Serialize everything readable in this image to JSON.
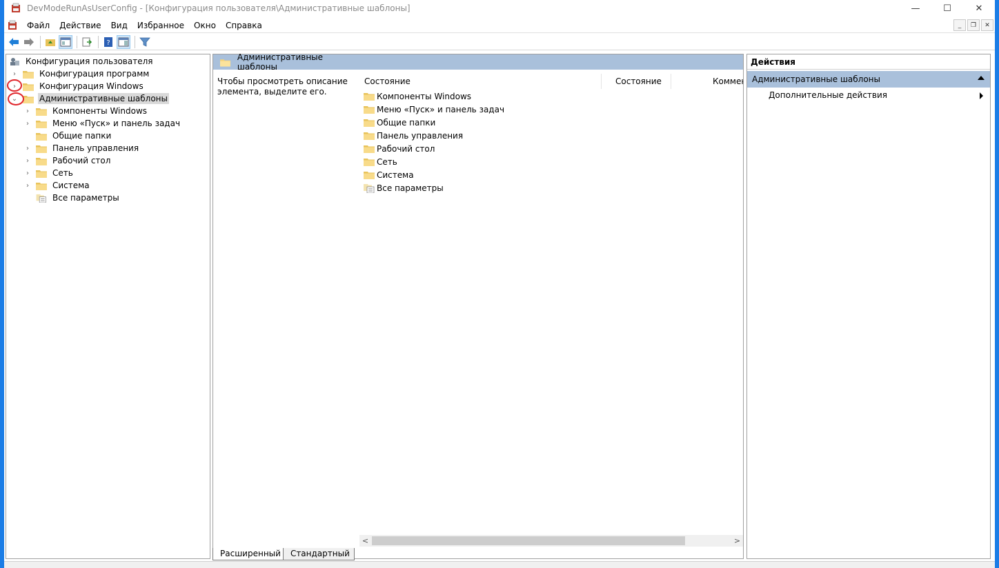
{
  "window": {
    "title": "DevModeRunAsUserConfig - [Конфигурация пользователя\\Административные шаблоны]",
    "minimize": "—",
    "maximize": "☐",
    "close": "✕"
  },
  "menu": {
    "items": [
      "Файл",
      "Действие",
      "Вид",
      "Избранное",
      "Окно",
      "Справка"
    ],
    "mdi_minimize": "_",
    "mdi_restore": "❐",
    "mdi_close": "✕"
  },
  "tree": {
    "root": "Конфигурация пользователя",
    "items": [
      {
        "label": "Конфигурация программ",
        "level": 1,
        "expander": "›"
      },
      {
        "label": "Конфигурация Windows",
        "level": 1,
        "expander": "›"
      },
      {
        "label": "Административные шаблоны",
        "level": 1,
        "expander": "⌄",
        "selected": true
      },
      {
        "label": "Компоненты Windows",
        "level": 2,
        "expander": "›"
      },
      {
        "label": "Меню «Пуск» и панель задач",
        "level": 2,
        "expander": "›"
      },
      {
        "label": "Общие папки",
        "level": 2,
        "expander": ""
      },
      {
        "label": "Панель управления",
        "level": 2,
        "expander": "›"
      },
      {
        "label": "Рабочий стол",
        "level": 2,
        "expander": "›"
      },
      {
        "label": "Сеть",
        "level": 2,
        "expander": "›"
      },
      {
        "label": "Система",
        "level": 2,
        "expander": "›"
      },
      {
        "label": "Все параметры",
        "level": 2,
        "expander": "",
        "icon": "settings-list-icon"
      }
    ]
  },
  "middle": {
    "header": "Административные шаблоны",
    "description": "Чтобы просмотреть описание элемента, выделите его.",
    "columns": [
      "Состояние",
      "Состояние",
      "Коммен"
    ],
    "items": [
      {
        "label": "Компоненты Windows"
      },
      {
        "label": "Меню «Пуск» и панель задач"
      },
      {
        "label": "Общие папки"
      },
      {
        "label": "Панель управления"
      },
      {
        "label": "Рабочий стол"
      },
      {
        "label": "Сеть"
      },
      {
        "label": "Система"
      },
      {
        "label": "Все параметры",
        "icon": "settings-list-icon"
      }
    ],
    "scroll_left": "<",
    "scroll_right": ">",
    "tabs": [
      "Расширенный",
      "Стандартный"
    ]
  },
  "actions": {
    "title": "Действия",
    "section": "Административные шаблоны",
    "item": "Дополнительные действия"
  },
  "colors": {
    "accent": "#1b7de6",
    "header_bg": "#a9c0db",
    "annotation": "#e0242a"
  }
}
